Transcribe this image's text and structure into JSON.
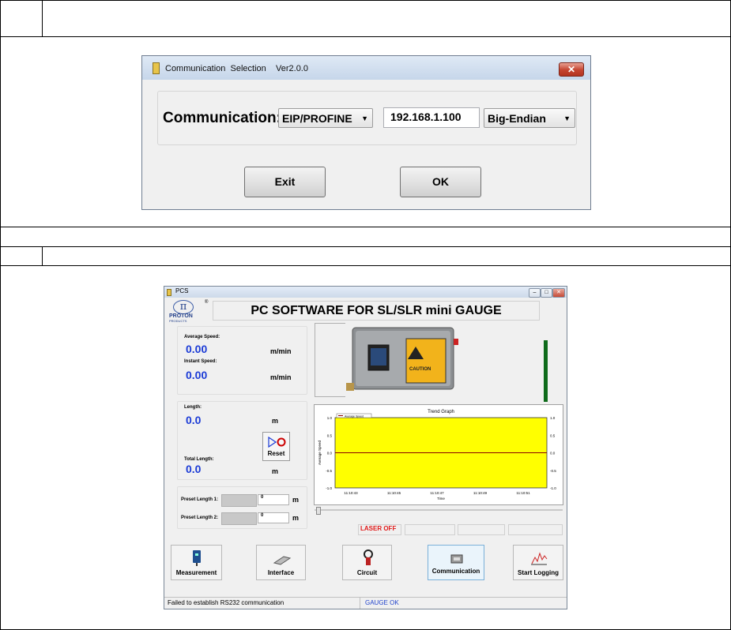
{
  "dialog": {
    "title": "Communication  Selection    Ver2.0.0",
    "close_label": "✕",
    "communication_label": "Communication:",
    "protocol_value": "EIP/PROFINE",
    "ip_value": "192.168.1.100",
    "endian_value": "Big-Endian",
    "exit_label": "Exit",
    "ok_label": "OK"
  },
  "pcs": {
    "title": "PCS",
    "heading": "PC SOFTWARE FOR SL/SLR mini GAUGE",
    "logo_text": "PROTON",
    "logo_sub": "PRODUCTS",
    "average_speed_label": "Average Speed:",
    "average_speed_value": "0.00",
    "average_speed_unit": "m/min",
    "instant_speed_label": "Instant Speed:",
    "instant_speed_value": "0.00",
    "instant_speed_unit": "m/min",
    "length_label": "Length:",
    "length_value": "0.0",
    "length_unit": "m",
    "reset_label": "Reset",
    "total_length_label": "Total Length:",
    "total_length_value": "0.0",
    "total_length_unit": "m",
    "preset1_label": "Preset Length 1:",
    "preset1_value": "0",
    "preset1_unit": "m",
    "preset2_label": "Preset Length 2:",
    "preset2_value": "0",
    "preset2_unit": "m",
    "laser_status": "LASER OFF",
    "toolbar": [
      {
        "label": "Measurement",
        "icon": "sensor-icon"
      },
      {
        "label": "Interface",
        "icon": "connector-icon"
      },
      {
        "label": "Circuit",
        "icon": "clamp-meter-icon"
      },
      {
        "label": "Communication",
        "icon": "device-icon"
      },
      {
        "label": "Start Logging",
        "icon": "chart-icon"
      }
    ],
    "status_message": "Failed to establish RS232 communication",
    "gauge_status": "GAUGE OK"
  },
  "chart_data": {
    "type": "line",
    "title": "Trend Graph",
    "xlabel": "Time",
    "ylabel": "Average Speed",
    "legend": [
      "Average Speed"
    ],
    "legend_position": "top-left",
    "x": [
      "11:10:43",
      "11:10:45",
      "11:10:47",
      "11:10:49",
      "11:10:51"
    ],
    "series": [
      {
        "name": "Average Speed",
        "values": [
          0,
          0,
          0,
          0,
          0
        ]
      }
    ],
    "yticks": [
      "1.0",
      "0.5",
      "0.0",
      "-0.5",
      "-1.0"
    ],
    "ylim": [
      -1.0,
      1.0
    ],
    "background": "#ffff00",
    "line_color": "#8b0000"
  }
}
